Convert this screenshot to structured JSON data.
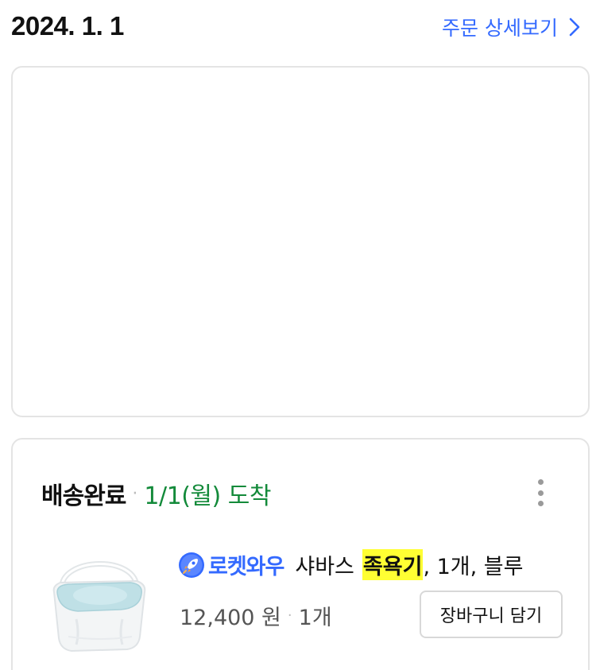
{
  "order": {
    "date": "2024. 1. 1",
    "detail_link_label": "주문 상세보기"
  },
  "shipment": {
    "status": "배송완료",
    "separator": "·",
    "arrival": "1/1(월) 도착"
  },
  "product": {
    "badge_label": "로켓와우",
    "name_prefix": "샤바스",
    "name_highlight": "족욕기",
    "name_suffix": ", 1개, 블루",
    "price": "12,400 원",
    "price_separator": "·",
    "quantity": "1개",
    "image_icon": "blue-foot-bath-bucket-image"
  },
  "actions": {
    "add_to_cart": "장바구니 담기"
  },
  "colors": {
    "link": "#346aff",
    "arrival": "#138a3a",
    "highlight": "#ffff33"
  }
}
